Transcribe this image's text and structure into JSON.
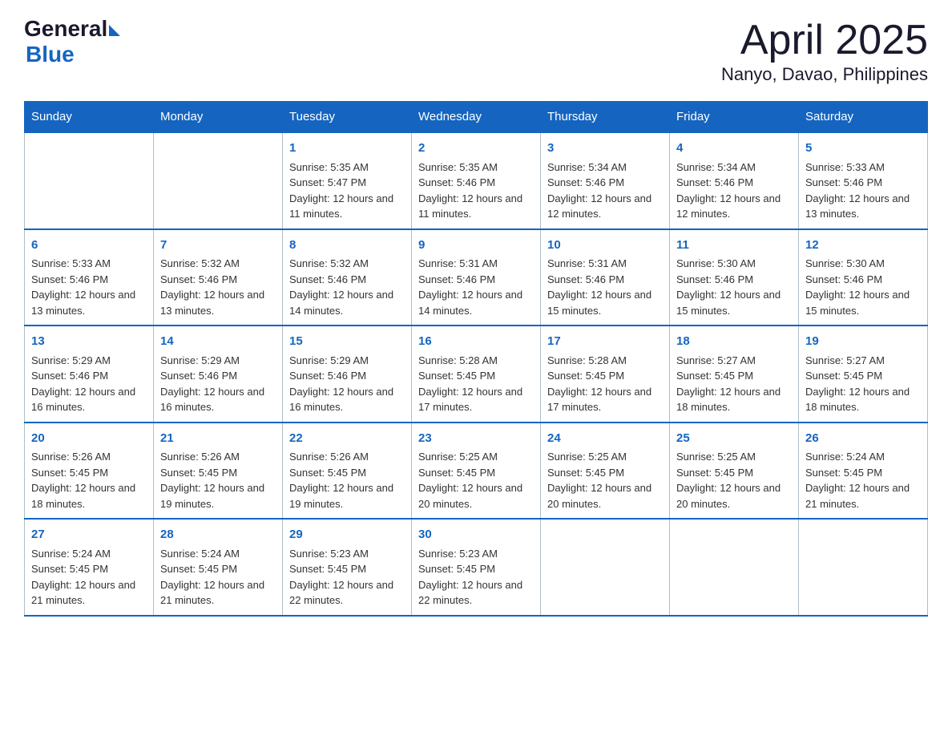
{
  "header": {
    "logo_general": "General",
    "logo_blue": "Blue",
    "month_title": "April 2025",
    "location": "Nanyo, Davao, Philippines"
  },
  "weekdays": [
    "Sunday",
    "Monday",
    "Tuesday",
    "Wednesday",
    "Thursday",
    "Friday",
    "Saturday"
  ],
  "weeks": [
    [
      {
        "day": "",
        "sunrise": "",
        "sunset": "",
        "daylight": ""
      },
      {
        "day": "",
        "sunrise": "",
        "sunset": "",
        "daylight": ""
      },
      {
        "day": "1",
        "sunrise": "Sunrise: 5:35 AM",
        "sunset": "Sunset: 5:47 PM",
        "daylight": "Daylight: 12 hours and 11 minutes."
      },
      {
        "day": "2",
        "sunrise": "Sunrise: 5:35 AM",
        "sunset": "Sunset: 5:46 PM",
        "daylight": "Daylight: 12 hours and 11 minutes."
      },
      {
        "day": "3",
        "sunrise": "Sunrise: 5:34 AM",
        "sunset": "Sunset: 5:46 PM",
        "daylight": "Daylight: 12 hours and 12 minutes."
      },
      {
        "day": "4",
        "sunrise": "Sunrise: 5:34 AM",
        "sunset": "Sunset: 5:46 PM",
        "daylight": "Daylight: 12 hours and 12 minutes."
      },
      {
        "day": "5",
        "sunrise": "Sunrise: 5:33 AM",
        "sunset": "Sunset: 5:46 PM",
        "daylight": "Daylight: 12 hours and 13 minutes."
      }
    ],
    [
      {
        "day": "6",
        "sunrise": "Sunrise: 5:33 AM",
        "sunset": "Sunset: 5:46 PM",
        "daylight": "Daylight: 12 hours and 13 minutes."
      },
      {
        "day": "7",
        "sunrise": "Sunrise: 5:32 AM",
        "sunset": "Sunset: 5:46 PM",
        "daylight": "Daylight: 12 hours and 13 minutes."
      },
      {
        "day": "8",
        "sunrise": "Sunrise: 5:32 AM",
        "sunset": "Sunset: 5:46 PM",
        "daylight": "Daylight: 12 hours and 14 minutes."
      },
      {
        "day": "9",
        "sunrise": "Sunrise: 5:31 AM",
        "sunset": "Sunset: 5:46 PM",
        "daylight": "Daylight: 12 hours and 14 minutes."
      },
      {
        "day": "10",
        "sunrise": "Sunrise: 5:31 AM",
        "sunset": "Sunset: 5:46 PM",
        "daylight": "Daylight: 12 hours and 15 minutes."
      },
      {
        "day": "11",
        "sunrise": "Sunrise: 5:30 AM",
        "sunset": "Sunset: 5:46 PM",
        "daylight": "Daylight: 12 hours and 15 minutes."
      },
      {
        "day": "12",
        "sunrise": "Sunrise: 5:30 AM",
        "sunset": "Sunset: 5:46 PM",
        "daylight": "Daylight: 12 hours and 15 minutes."
      }
    ],
    [
      {
        "day": "13",
        "sunrise": "Sunrise: 5:29 AM",
        "sunset": "Sunset: 5:46 PM",
        "daylight": "Daylight: 12 hours and 16 minutes."
      },
      {
        "day": "14",
        "sunrise": "Sunrise: 5:29 AM",
        "sunset": "Sunset: 5:46 PM",
        "daylight": "Daylight: 12 hours and 16 minutes."
      },
      {
        "day": "15",
        "sunrise": "Sunrise: 5:29 AM",
        "sunset": "Sunset: 5:46 PM",
        "daylight": "Daylight: 12 hours and 16 minutes."
      },
      {
        "day": "16",
        "sunrise": "Sunrise: 5:28 AM",
        "sunset": "Sunset: 5:45 PM",
        "daylight": "Daylight: 12 hours and 17 minutes."
      },
      {
        "day": "17",
        "sunrise": "Sunrise: 5:28 AM",
        "sunset": "Sunset: 5:45 PM",
        "daylight": "Daylight: 12 hours and 17 minutes."
      },
      {
        "day": "18",
        "sunrise": "Sunrise: 5:27 AM",
        "sunset": "Sunset: 5:45 PM",
        "daylight": "Daylight: 12 hours and 18 minutes."
      },
      {
        "day": "19",
        "sunrise": "Sunrise: 5:27 AM",
        "sunset": "Sunset: 5:45 PM",
        "daylight": "Daylight: 12 hours and 18 minutes."
      }
    ],
    [
      {
        "day": "20",
        "sunrise": "Sunrise: 5:26 AM",
        "sunset": "Sunset: 5:45 PM",
        "daylight": "Daylight: 12 hours and 18 minutes."
      },
      {
        "day": "21",
        "sunrise": "Sunrise: 5:26 AM",
        "sunset": "Sunset: 5:45 PM",
        "daylight": "Daylight: 12 hours and 19 minutes."
      },
      {
        "day": "22",
        "sunrise": "Sunrise: 5:26 AM",
        "sunset": "Sunset: 5:45 PM",
        "daylight": "Daylight: 12 hours and 19 minutes."
      },
      {
        "day": "23",
        "sunrise": "Sunrise: 5:25 AM",
        "sunset": "Sunset: 5:45 PM",
        "daylight": "Daylight: 12 hours and 20 minutes."
      },
      {
        "day": "24",
        "sunrise": "Sunrise: 5:25 AM",
        "sunset": "Sunset: 5:45 PM",
        "daylight": "Daylight: 12 hours and 20 minutes."
      },
      {
        "day": "25",
        "sunrise": "Sunrise: 5:25 AM",
        "sunset": "Sunset: 5:45 PM",
        "daylight": "Daylight: 12 hours and 20 minutes."
      },
      {
        "day": "26",
        "sunrise": "Sunrise: 5:24 AM",
        "sunset": "Sunset: 5:45 PM",
        "daylight": "Daylight: 12 hours and 21 minutes."
      }
    ],
    [
      {
        "day": "27",
        "sunrise": "Sunrise: 5:24 AM",
        "sunset": "Sunset: 5:45 PM",
        "daylight": "Daylight: 12 hours and 21 minutes."
      },
      {
        "day": "28",
        "sunrise": "Sunrise: 5:24 AM",
        "sunset": "Sunset: 5:45 PM",
        "daylight": "Daylight: 12 hours and 21 minutes."
      },
      {
        "day": "29",
        "sunrise": "Sunrise: 5:23 AM",
        "sunset": "Sunset: 5:45 PM",
        "daylight": "Daylight: 12 hours and 22 minutes."
      },
      {
        "day": "30",
        "sunrise": "Sunrise: 5:23 AM",
        "sunset": "Sunset: 5:45 PM",
        "daylight": "Daylight: 12 hours and 22 minutes."
      },
      {
        "day": "",
        "sunrise": "",
        "sunset": "",
        "daylight": ""
      },
      {
        "day": "",
        "sunrise": "",
        "sunset": "",
        "daylight": ""
      },
      {
        "day": "",
        "sunrise": "",
        "sunset": "",
        "daylight": ""
      }
    ]
  ]
}
